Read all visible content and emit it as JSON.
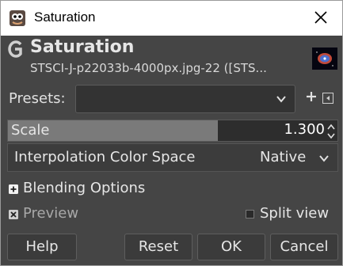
{
  "window": {
    "title": "Saturation",
    "app_icon": "gimp-wilber-icon",
    "close_icon": "close-icon"
  },
  "header": {
    "title": "Saturation",
    "subtitle": "STSCI-J-p22033b-4000px.jpg-22 ([STS...",
    "logo_icon": "gimp-g-icon",
    "thumbnail": "image-thumbnail"
  },
  "presets": {
    "label": "Presets:",
    "value": "",
    "add_icon": "plus-icon",
    "menu_icon": "menu-arrow-icon"
  },
  "scale": {
    "label": "Scale",
    "value": "1.300",
    "fill_fraction": 0.6375
  },
  "color_space": {
    "label": "Interpolation Color Space",
    "value": "Native"
  },
  "blending": {
    "label": "Blending Options",
    "icon": "expand-plus-icon"
  },
  "preview": {
    "label": "Preview",
    "checked": true
  },
  "split_view": {
    "label": "Split view",
    "checked": false
  },
  "buttons": {
    "help": "Help",
    "reset": "Reset",
    "ok": "OK",
    "cancel": "Cancel"
  },
  "colors": {
    "dialog_bg": "#454545",
    "titlebar_bg": "#ffffff",
    "text": "#e6e6e6"
  }
}
